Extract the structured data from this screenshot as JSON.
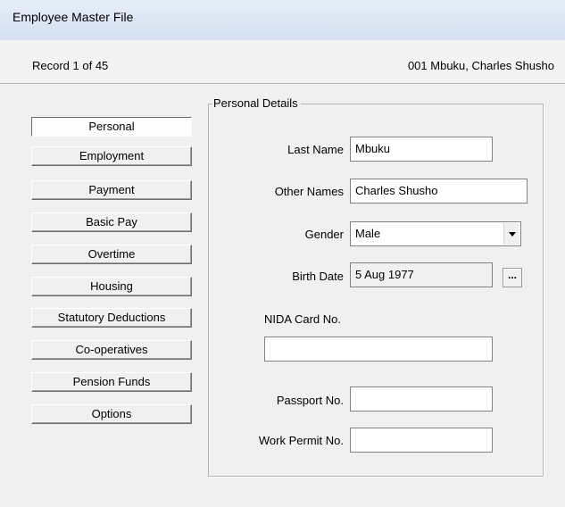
{
  "window": {
    "title": "Employee Master File"
  },
  "record": {
    "position": "Record 1 of 45",
    "employee": "001  Mbuku, Charles Shusho"
  },
  "nav": {
    "items": [
      {
        "label": "Personal"
      },
      {
        "label": "Employment"
      },
      {
        "label": "Payment"
      },
      {
        "label": "Basic Pay"
      },
      {
        "label": "Overtime"
      },
      {
        "label": "Housing"
      },
      {
        "label": "Statutory Deductions"
      },
      {
        "label": "Co-operatives"
      },
      {
        "label": "Pension Funds"
      },
      {
        "label": "Options"
      }
    ],
    "active": "Personal"
  },
  "personal": {
    "group_title": "Personal Details",
    "last_name_label": "Last Name",
    "last_name_value": "Mbuku",
    "other_names_label": "Other Names",
    "other_names_value": "Charles Shusho",
    "gender_label": "Gender",
    "gender_value": "Male",
    "birth_date_label": "Birth Date",
    "birth_date_value": "5 Aug 1977",
    "birth_date_button": "...",
    "nida_label": "NIDA Card No.",
    "nida_value": "",
    "passport_label": "Passport No.",
    "passport_value": "",
    "work_permit_label": "Work Permit No.",
    "work_permit_value": ""
  },
  "icons": {
    "gender_dropdown": "chevron-down-icon"
  }
}
